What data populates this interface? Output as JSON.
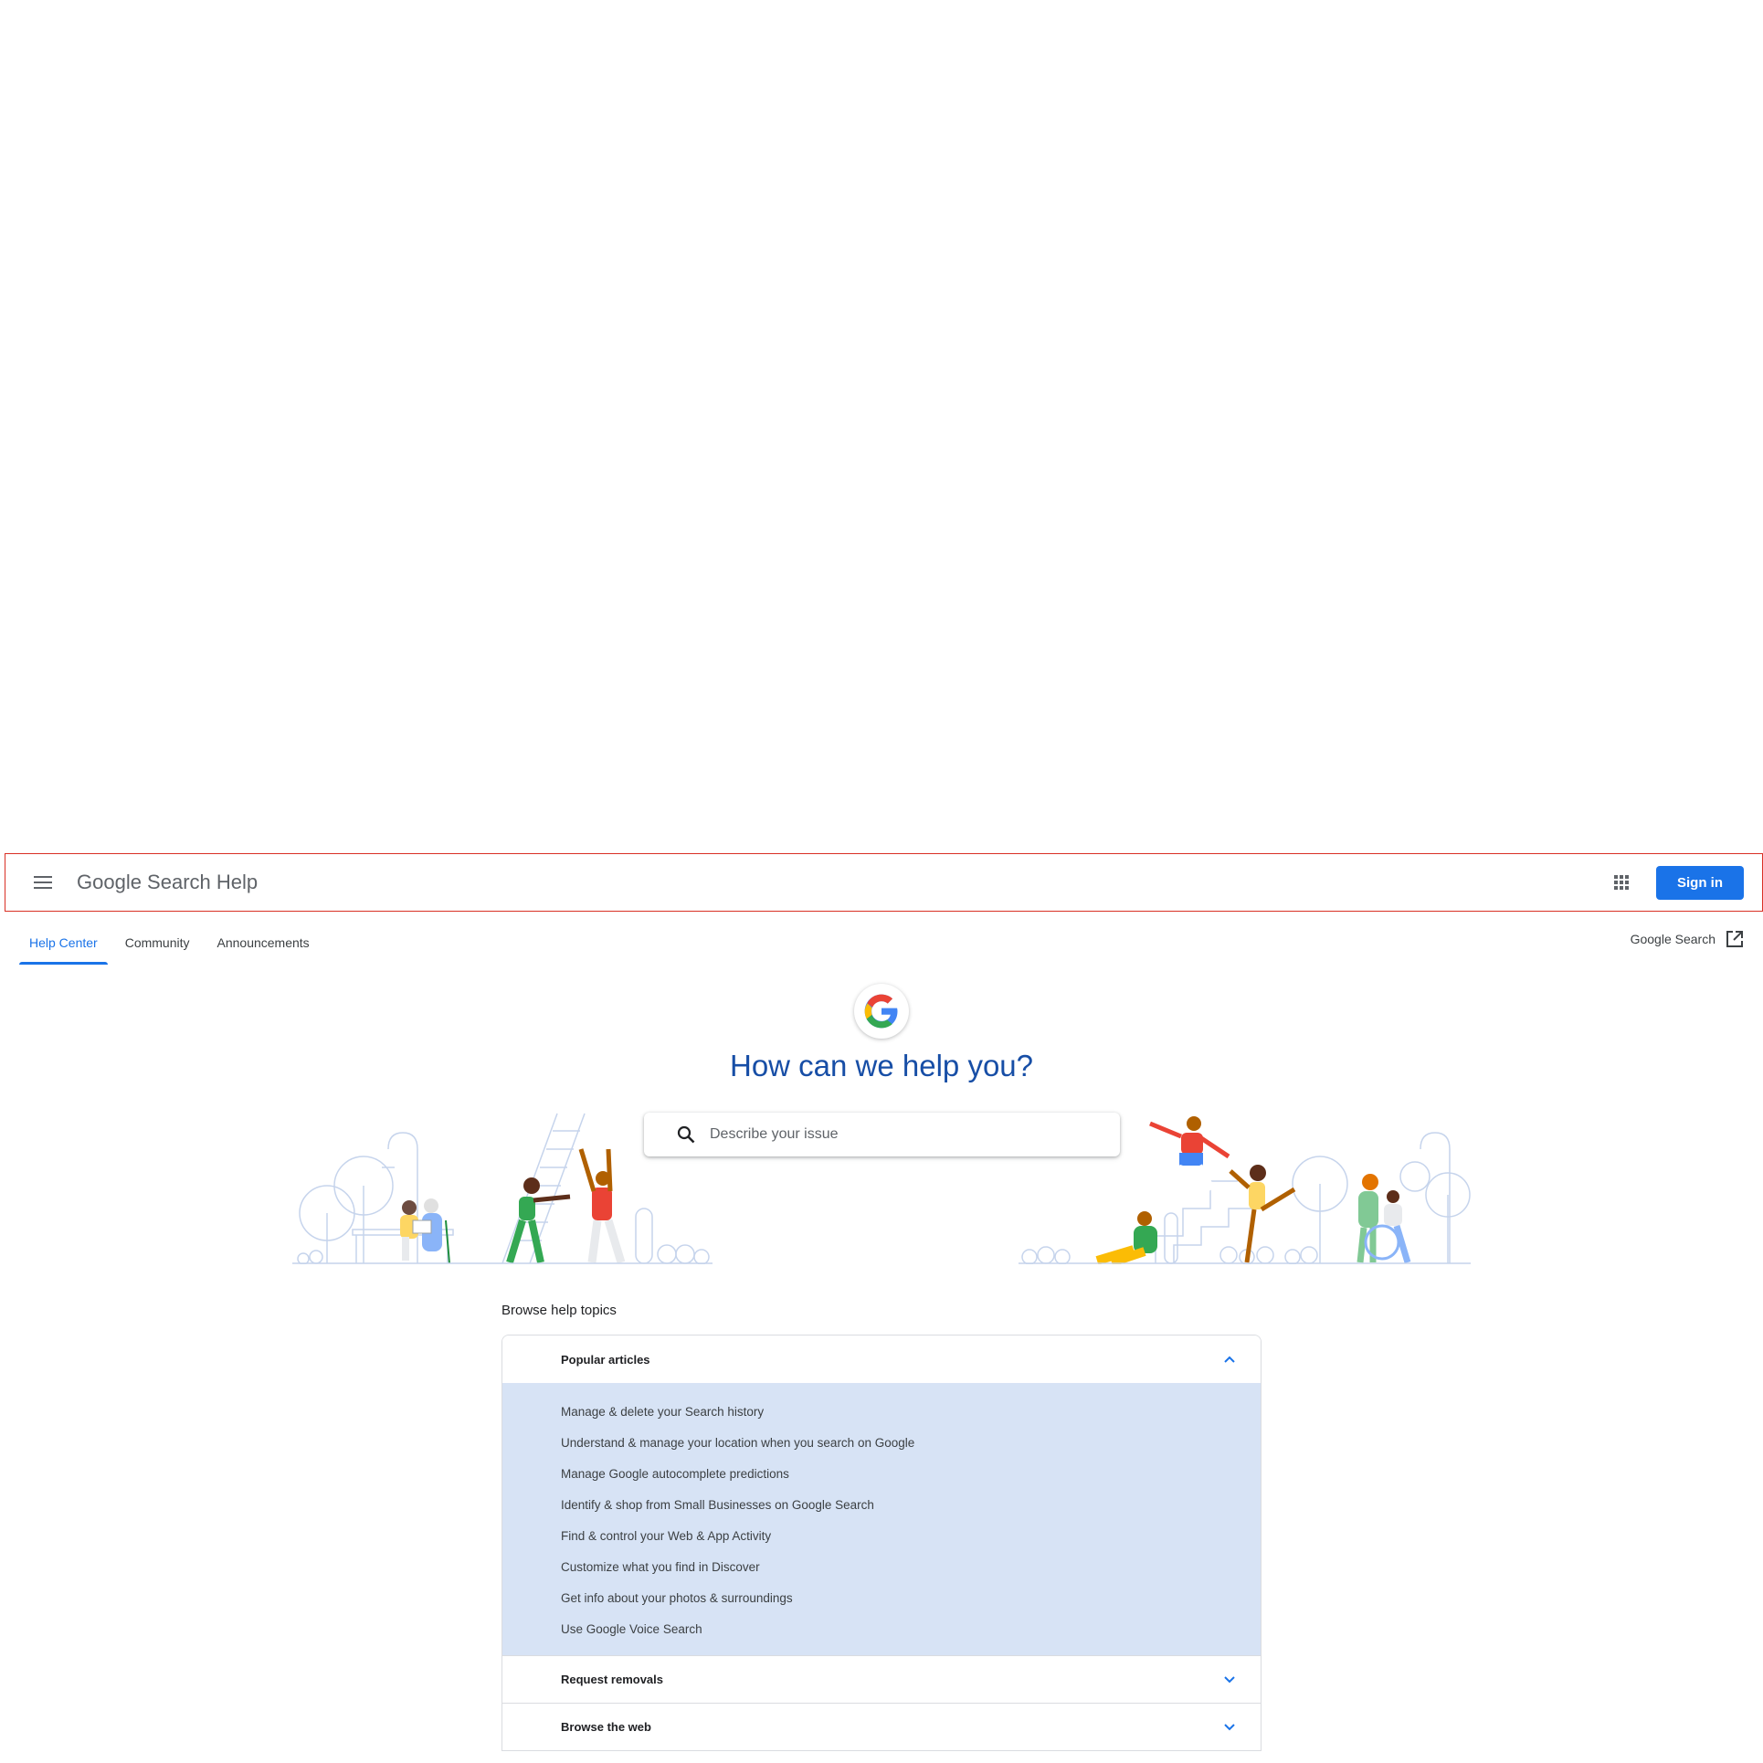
{
  "header": {
    "menu_icon": "hamburger-menu-icon",
    "title": "Google Search Help",
    "apps_icon": "apps-grid-icon",
    "signin_label": "Sign in",
    "accent_color": "#1a73e8"
  },
  "tabs": [
    {
      "label": "Help Center",
      "active": true
    },
    {
      "label": "Community",
      "active": false
    },
    {
      "label": "Announcements",
      "active": false
    }
  ],
  "external_link": {
    "label": "Google Search",
    "icon": "open-in-new-icon"
  },
  "hero": {
    "logo_icon": "google-g-logo-icon",
    "title": "How can we help you?",
    "title_color": "#174ea6",
    "search_placeholder": "Describe your issue",
    "search_icon": "search-icon"
  },
  "browse": {
    "heading": "Browse help topics",
    "topics": [
      {
        "title": "Popular articles",
        "expanded": true,
        "articles": [
          "Manage & delete your Search history",
          "Understand & manage your location when you search on Google",
          "Manage Google autocomplete predictions",
          "Identify & shop from Small Businesses on Google Search",
          "Find & control your Web & App Activity",
          "Customize what you find in Discover",
          "Get info about your photos & surroundings",
          "Use Google Voice Search"
        ]
      },
      {
        "title": "Request removals",
        "expanded": false
      },
      {
        "title": "Browse the web",
        "expanded": false
      }
    ],
    "expanded_bg": "#d7e3f5"
  }
}
